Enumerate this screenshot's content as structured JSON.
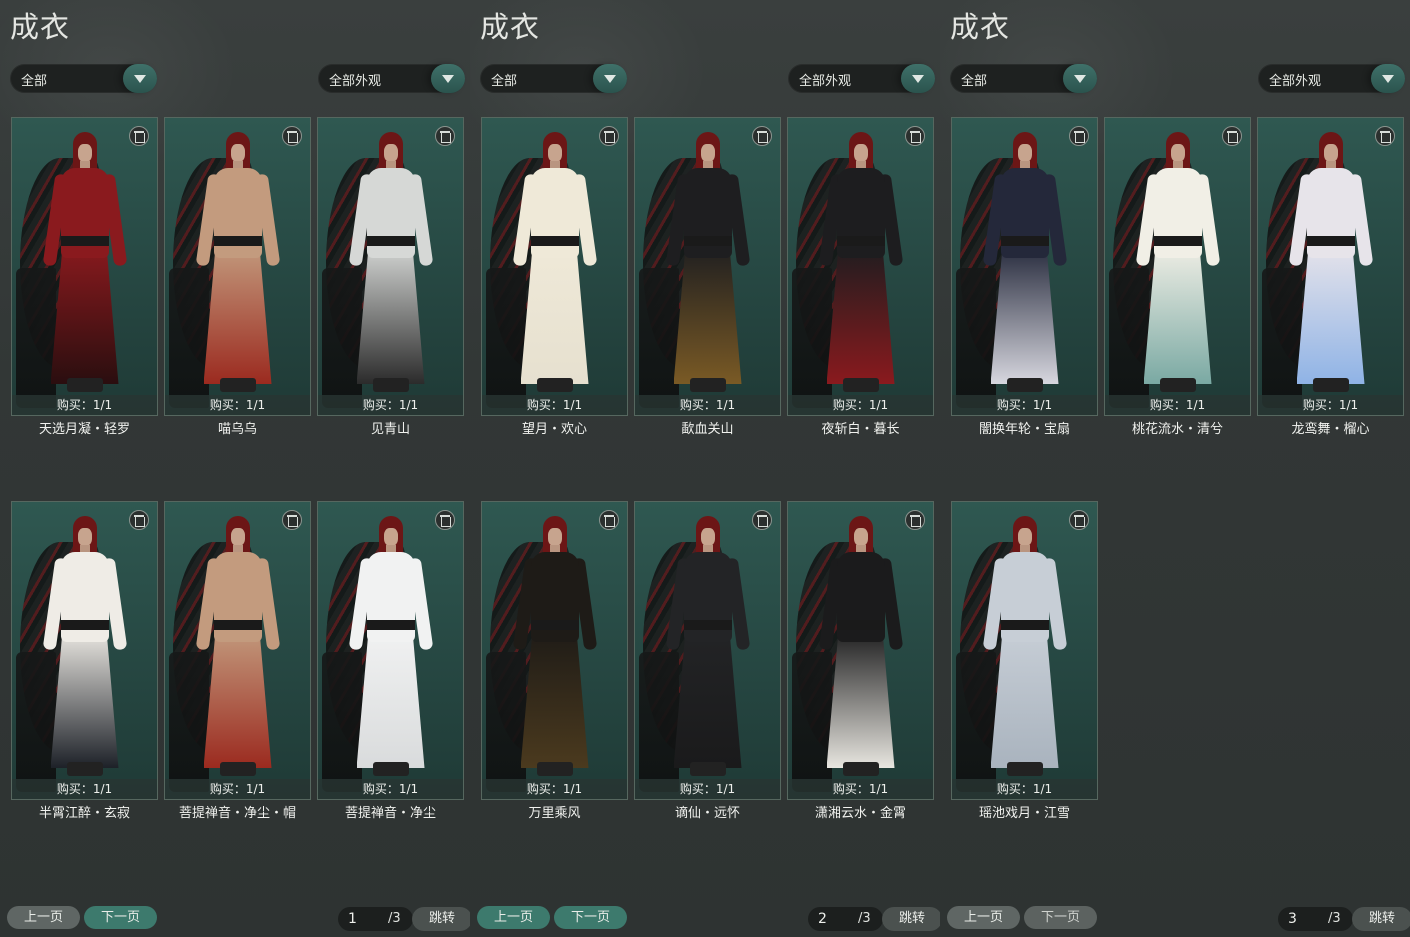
{
  "panels": [
    {
      "title": "成衣",
      "filter1": "全部",
      "filter2": "全部外观",
      "cards": [
        {
          "name": "天选月凝・轻罗",
          "buy": "购买：1/1",
          "color": "#8a1a1e",
          "accent": "#2a0e0f"
        },
        {
          "name": "喵乌乌",
          "buy": "购买：1/1",
          "color": "#c39b7e",
          "accent": "#9b2a1f"
        },
        {
          "name": "见青山",
          "buy": "购买：1/1",
          "color": "#d6d8d6",
          "accent": "#2b2b2b"
        },
        {
          "name": "半霄江醉・玄寂",
          "buy": "购买：1/1",
          "color": "#efece6",
          "accent": "#1d2128"
        },
        {
          "name": "菩提禅音・净尘・帽",
          "buy": "购买：1/1",
          "color": "#c39b7e",
          "accent": "#9b2a1f"
        },
        {
          "name": "菩提禅音・净尘",
          "buy": "购买：1/1",
          "color": "#f1f2f2",
          "accent": "#d9dbdc"
        }
      ],
      "pager": {
        "prev": "上一页",
        "next": "下一页",
        "current": "1",
        "total": "/3",
        "jump": "跳转"
      }
    },
    {
      "title": "成衣",
      "filter1": "全部",
      "filter2": "全部外观",
      "cards": [
        {
          "name": "望月・欢心",
          "buy": "购买：1/1",
          "color": "#efe9d8",
          "accent": "#e6e0cf"
        },
        {
          "name": "歃血关山",
          "buy": "购买：1/1",
          "color": "#1e1e20",
          "accent": "#7a5a25"
        },
        {
          "name": "夜斩白・暮长",
          "buy": "购买：1/1",
          "color": "#1d1d1f",
          "accent": "#8a1a1e"
        },
        {
          "name": "万里乘风",
          "buy": "购买：1/1",
          "color": "#1e1b17",
          "accent": "#4b3a1e"
        },
        {
          "name": "谪仙・远怀",
          "buy": "购买：1/1",
          "color": "#232426",
          "accent": "#1a1a1b"
        },
        {
          "name": "潇湘云水・金霄",
          "buy": "购买：1/1",
          "color": "#1b1b1c",
          "accent": "#e8e6e0"
        }
      ],
      "pager": {
        "prev": "上一页",
        "next": "下一页",
        "current": "2",
        "total": "/3",
        "jump": "跳转"
      }
    },
    {
      "title": "成衣",
      "filter1": "全部",
      "filter2": "全部外观",
      "cards": [
        {
          "name": "闇换年轮・宝扇",
          "buy": "购买：1/1",
          "color": "#24283a",
          "accent": "#d7d7df"
        },
        {
          "name": "桃花流水・清兮",
          "buy": "购买：1/1",
          "color": "#f1efe6",
          "accent": "#7aa9a3"
        },
        {
          "name": "龙鸾舞・榴心",
          "buy": "购买：1/1",
          "color": "#e7e4ea",
          "accent": "#8fb3e6"
        },
        {
          "name": "瑶池戏月・江雪",
          "buy": "购买：1/1",
          "color": "#c7ced6",
          "accent": "#a9b3be"
        }
      ],
      "pager": {
        "prev": "上一页",
        "next": "下一页",
        "current": "3",
        "total": "/3",
        "jump": "跳转"
      }
    }
  ]
}
